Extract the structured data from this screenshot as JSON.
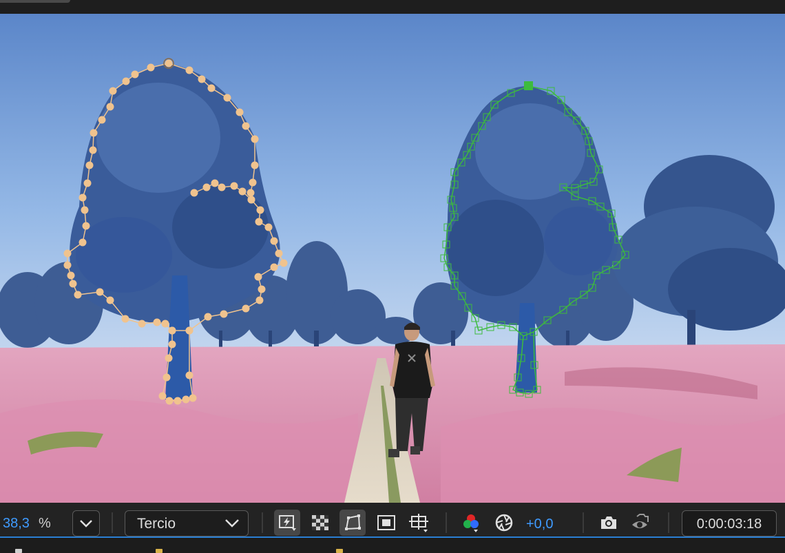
{
  "viewer": {
    "scene": "composition-preview",
    "mask_colors": {
      "left_mask": "#f0c38e",
      "right_mask": "#3dbb3d"
    }
  },
  "controls": {
    "zoom_value": "38,3",
    "zoom_unit": "%",
    "resolution": "Tercio",
    "exposure_value": "+0,0",
    "timecode": "0:00:03:18"
  },
  "icons": {
    "zoom_menu": "chevron-down-icon",
    "resolution_menu": "chevron-down-icon",
    "fast_previews": "fast-previews-icon",
    "transparency_grid": "checkerboard-icon",
    "mask_visibility": "mask-path-icon",
    "region_of_interest": "region-of-interest-icon",
    "guides": "guides-grid-icon",
    "channels": "rgb-channels-icon",
    "reset_exposure": "aperture-icon",
    "snapshot": "camera-icon",
    "show_snapshot": "camera-view-icon"
  },
  "colors": {
    "accent": "#3f9bff",
    "panel": "#232323"
  }
}
